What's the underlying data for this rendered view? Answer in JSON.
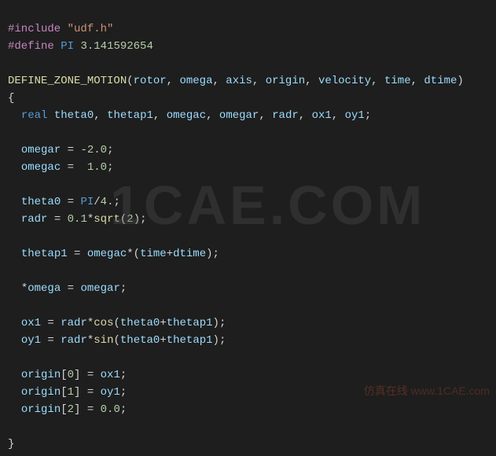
{
  "code": {
    "l1": {
      "macro": "#include",
      "space": " ",
      "str": "\"udf.h\""
    },
    "l2": {
      "macro": "#define",
      "space": " ",
      "name": "PI",
      "space2": " ",
      "val": "3.141592654"
    },
    "l4": {
      "fn": "DEFINE_ZONE_MOTION",
      "open": "(",
      "p1": "rotor",
      "c": ", ",
      "p2": "omega",
      "p3": "axis",
      "p4": "origin",
      "p5": "velocity",
      "p6": "time",
      "p7": "dtime",
      "close": ")"
    },
    "l5": "{",
    "l6": {
      "indent": "  ",
      "type": "real",
      "sp": " ",
      "v1": "theta0",
      "c": ", ",
      "v2": "thetap1",
      "v3": "omegac",
      "v4": "omegar",
      "v5": "radr",
      "v6": "ox1",
      "v7": "oy1",
      "semi": ";"
    },
    "l8": {
      "indent": "  ",
      "v": "omegar",
      "eq": " = ",
      "neg": "-",
      "n": "2.0",
      "semi": ";"
    },
    "l9": {
      "indent": "  ",
      "v": "omegac",
      "eq": " =  ",
      "n": "1.0",
      "semi": ";"
    },
    "l11": {
      "indent": "  ",
      "v": "theta0",
      "eq": " = ",
      "pi": "PI",
      "op": "/",
      "n": "4.",
      "semi": ";"
    },
    "l12": {
      "indent": "  ",
      "v": "radr",
      "eq": " = ",
      "n1": "0.1",
      "op": "*",
      "fn": "sqrt",
      "open": "(",
      "n2": "2",
      "close": ")",
      "semi": ";"
    },
    "l14": {
      "indent": "  ",
      "v": "thetap1",
      "eq": " = ",
      "v2": "omegac",
      "op": "*(",
      "v3": "time",
      "plus": "+",
      "v4": "dtime",
      "close": ")",
      "semi": ";"
    },
    "l16": {
      "indent": "  ",
      "op": "*",
      "v": "omega",
      "eq": " = ",
      "v2": "omegar",
      "semi": ";"
    },
    "l18": {
      "indent": "  ",
      "v": "ox1",
      "eq": " = ",
      "v2": "radr",
      "op": "*",
      "fn": "cos",
      "open": "(",
      "v3": "theta0",
      "plus": "+",
      "v4": "thetap1",
      "close": ")",
      "semi": ";"
    },
    "l19": {
      "indent": "  ",
      "v": "oy1",
      "eq": " = ",
      "v2": "radr",
      "op": "*",
      "fn": "sin",
      "open": "(",
      "v3": "theta0",
      "plus": "+",
      "v4": "thetap1",
      "close": ")",
      "semi": ";"
    },
    "l21": {
      "indent": "  ",
      "v": "origin",
      "br": "[",
      "n": "0",
      "br2": "] = ",
      "v2": "ox1",
      "semi": ";"
    },
    "l22": {
      "indent": "  ",
      "v": "origin",
      "br": "[",
      "n": "1",
      "br2": "] = ",
      "v2": "oy1",
      "semi": ";"
    },
    "l23": {
      "indent": "  ",
      "v": "origin",
      "br": "[",
      "n": "2",
      "br2": "] = ",
      "n2": "0.0",
      "semi": ";"
    },
    "l25": "}"
  },
  "watermark": {
    "big": "1CAE.COM",
    "footer_cn": "仿真在线 ",
    "footer_url": "www.1CAE.com"
  }
}
